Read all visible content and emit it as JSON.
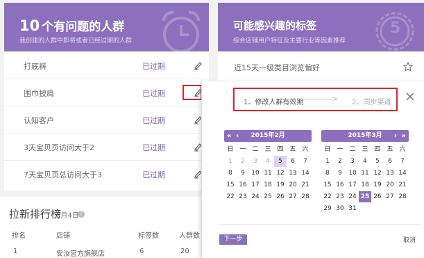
{
  "left_card": {
    "title_num": "10",
    "title": "个有问题的人群",
    "subtitle": "我创建的人群中即将或者已经过期的人群",
    "rows": [
      {
        "name": "打底裤",
        "status": "已过期"
      },
      {
        "name": "围巾披肩",
        "status": "已过期"
      },
      {
        "name": "认知客户",
        "status": "已过期"
      },
      {
        "name": "3天宝贝页访问大于2",
        "status": "已过期"
      },
      {
        "name": "7天宝贝页总访问大于3",
        "status": "已过期"
      }
    ]
  },
  "right_card": {
    "title": "可能感兴趣的标签",
    "subtitle": "综合店铺用户特征及主要行业等因素推荐",
    "badge_num": "5",
    "first_tag": "近15天一级类目浏览偏好"
  },
  "ranking": {
    "title": "拉新排行榜",
    "date": "2月4日",
    "help": "?",
    "headers": [
      "排名",
      "店铺",
      "标签数",
      "人群数"
    ],
    "row": [
      "1",
      "安汝宫方旗舰店",
      "6",
      "20"
    ]
  },
  "popup": {
    "step1": "1、修改人群有效期",
    "arrow": "------------->",
    "step2": "2、同步渠道",
    "weekdays": [
      "日",
      "一",
      "二",
      "三",
      "四",
      "五",
      "六"
    ],
    "cal_left": {
      "title": "2015年2月",
      "prev_double": "«",
      "prev": "‹",
      "rows": [
        [
          "1",
          "2",
          "3",
          "4",
          "5",
          "6",
          "7"
        ],
        [
          "8",
          "9",
          "10",
          "11",
          "12",
          "13",
          "14"
        ],
        [
          "15",
          "16",
          "17",
          "18",
          "19",
          "20",
          "21"
        ],
        [
          "22",
          "23",
          "24",
          "25",
          "26",
          "27",
          "28"
        ]
      ]
    },
    "cal_right": {
      "title": "2015年3月",
      "next": "›",
      "next_double": "»",
      "rows": [
        [
          "1",
          "2",
          "3",
          "4",
          "5",
          "6",
          "7"
        ],
        [
          "8",
          "9",
          "10",
          "11",
          "12",
          "13",
          "14"
        ],
        [
          "15",
          "16",
          "17",
          "18",
          "19",
          "20",
          "21"
        ],
        [
          "22",
          "23",
          "24",
          "25",
          "26",
          "27",
          "28"
        ],
        [
          "29",
          "30",
          "31",
          "",
          "",
          "",
          ""
        ]
      ]
    },
    "next_btn": "下一步",
    "cancel": "取消",
    "close": "×"
  },
  "colors": {
    "accent": "#8d70bd",
    "highlight": "#d8262a"
  },
  "icons": {
    "edit": "pencil-icon",
    "star": "star-icon",
    "close": "close-icon"
  }
}
